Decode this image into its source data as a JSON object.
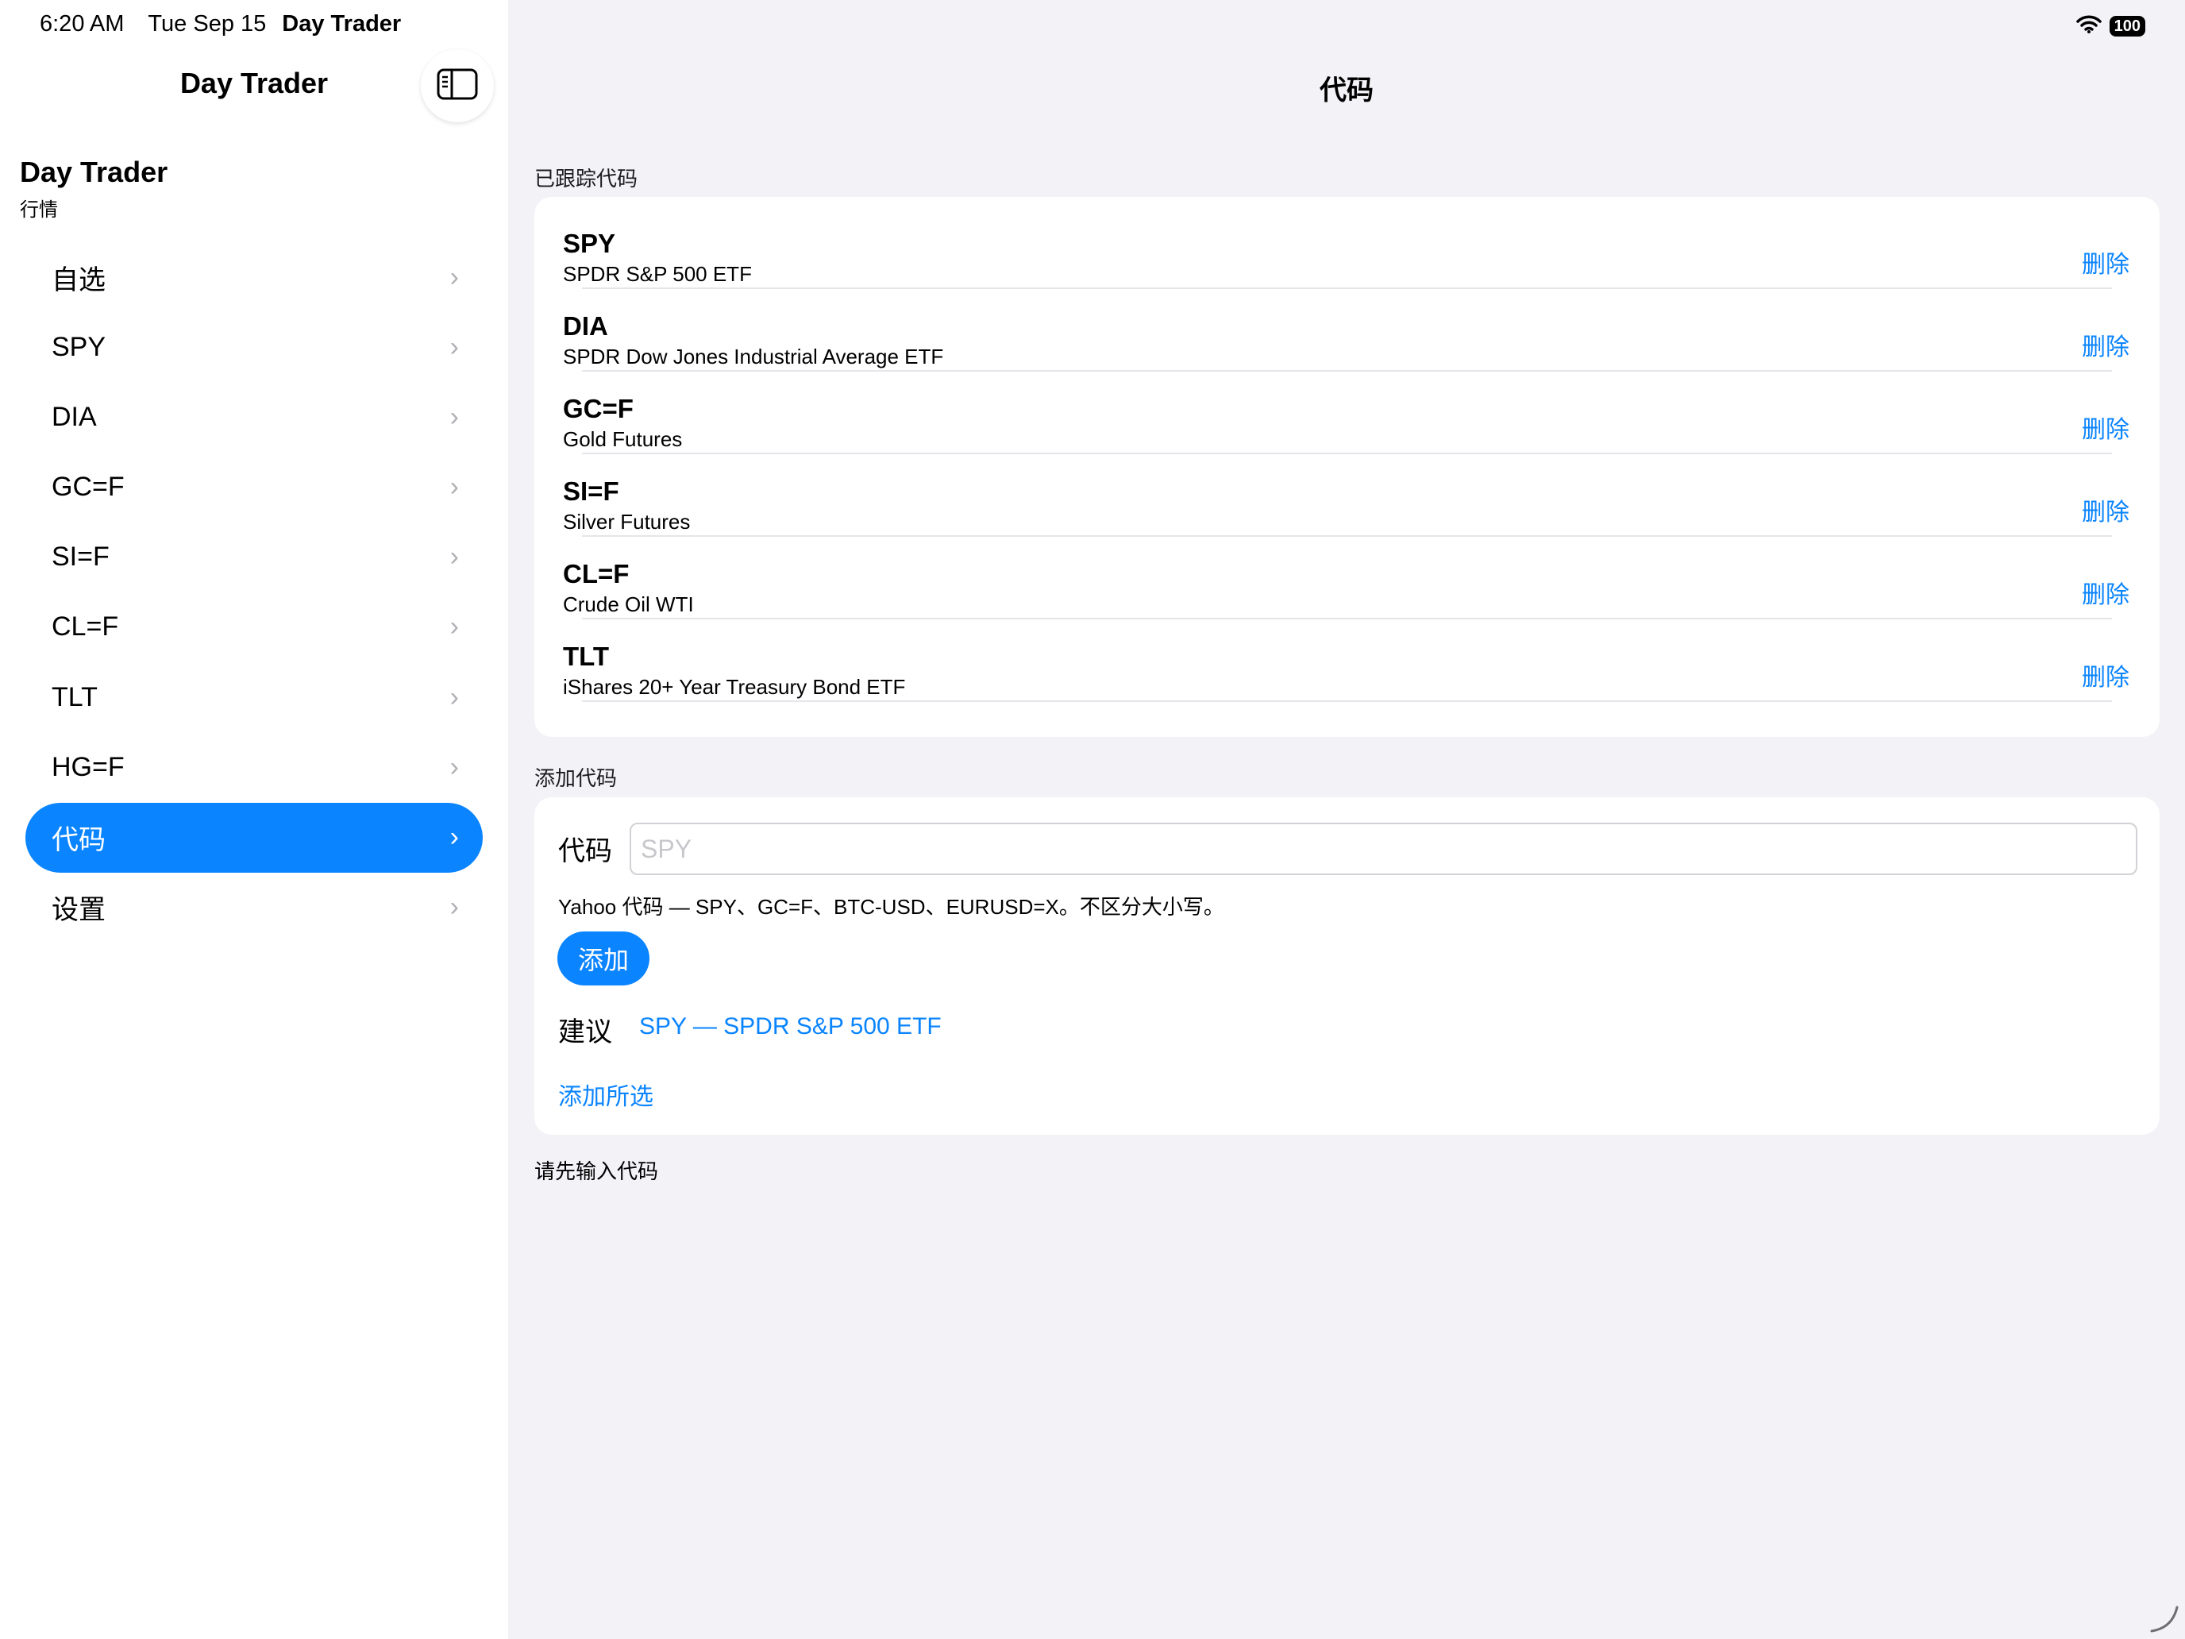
{
  "status_bar": {
    "time": "6:20 AM",
    "date": "Tue Sep 15",
    "app": "Day Trader",
    "battery": "100"
  },
  "sidebar": {
    "nav_title": "Day Trader",
    "toggle_icon": "sidebar-toggle-icon",
    "header_title": "Day Trader",
    "header_subtitle": "行情",
    "items": [
      {
        "label": "自选",
        "selected": false
      },
      {
        "label": "SPY",
        "selected": false
      },
      {
        "label": "DIA",
        "selected": false
      },
      {
        "label": "GC=F",
        "selected": false
      },
      {
        "label": "SI=F",
        "selected": false
      },
      {
        "label": "CL=F",
        "selected": false
      },
      {
        "label": "TLT",
        "selected": false
      },
      {
        "label": "HG=F",
        "selected": false
      },
      {
        "label": "代码",
        "selected": true
      },
      {
        "label": "设置",
        "selected": false
      }
    ]
  },
  "main": {
    "title": "代码",
    "tracked_section_label": "已跟踪代码",
    "tracked": [
      {
        "symbol": "SPY",
        "name": "SPDR S&P 500 ETF",
        "action": "删除"
      },
      {
        "symbol": "DIA",
        "name": "SPDR Dow Jones Industrial Average ETF",
        "action": "删除"
      },
      {
        "symbol": "GC=F",
        "name": "Gold Futures",
        "action": "删除"
      },
      {
        "symbol": "SI=F",
        "name": "Silver Futures",
        "action": "删除"
      },
      {
        "symbol": "CL=F",
        "name": "Crude Oil WTI",
        "action": "删除"
      },
      {
        "symbol": "TLT",
        "name": "iShares 20+ Year Treasury Bond ETF",
        "action": "删除"
      }
    ],
    "add_section_label": "添加代码",
    "add": {
      "field_label": "代码",
      "input_value": "",
      "input_placeholder": "SPY",
      "hint": "Yahoo 代码 — SPY、GC=F、BTC-USD、EURUSD=X。不区分大小写。",
      "add_button": "添加",
      "suggestion_label": "建议",
      "suggestion_value": "SPY — SPDR S&P 500 ETF",
      "add_selected": "添加所选"
    },
    "footer_hint": "请先输入代码"
  },
  "colors": {
    "accent": "#0a84ff",
    "background": "#f2f2f7",
    "card": "#ffffff"
  }
}
